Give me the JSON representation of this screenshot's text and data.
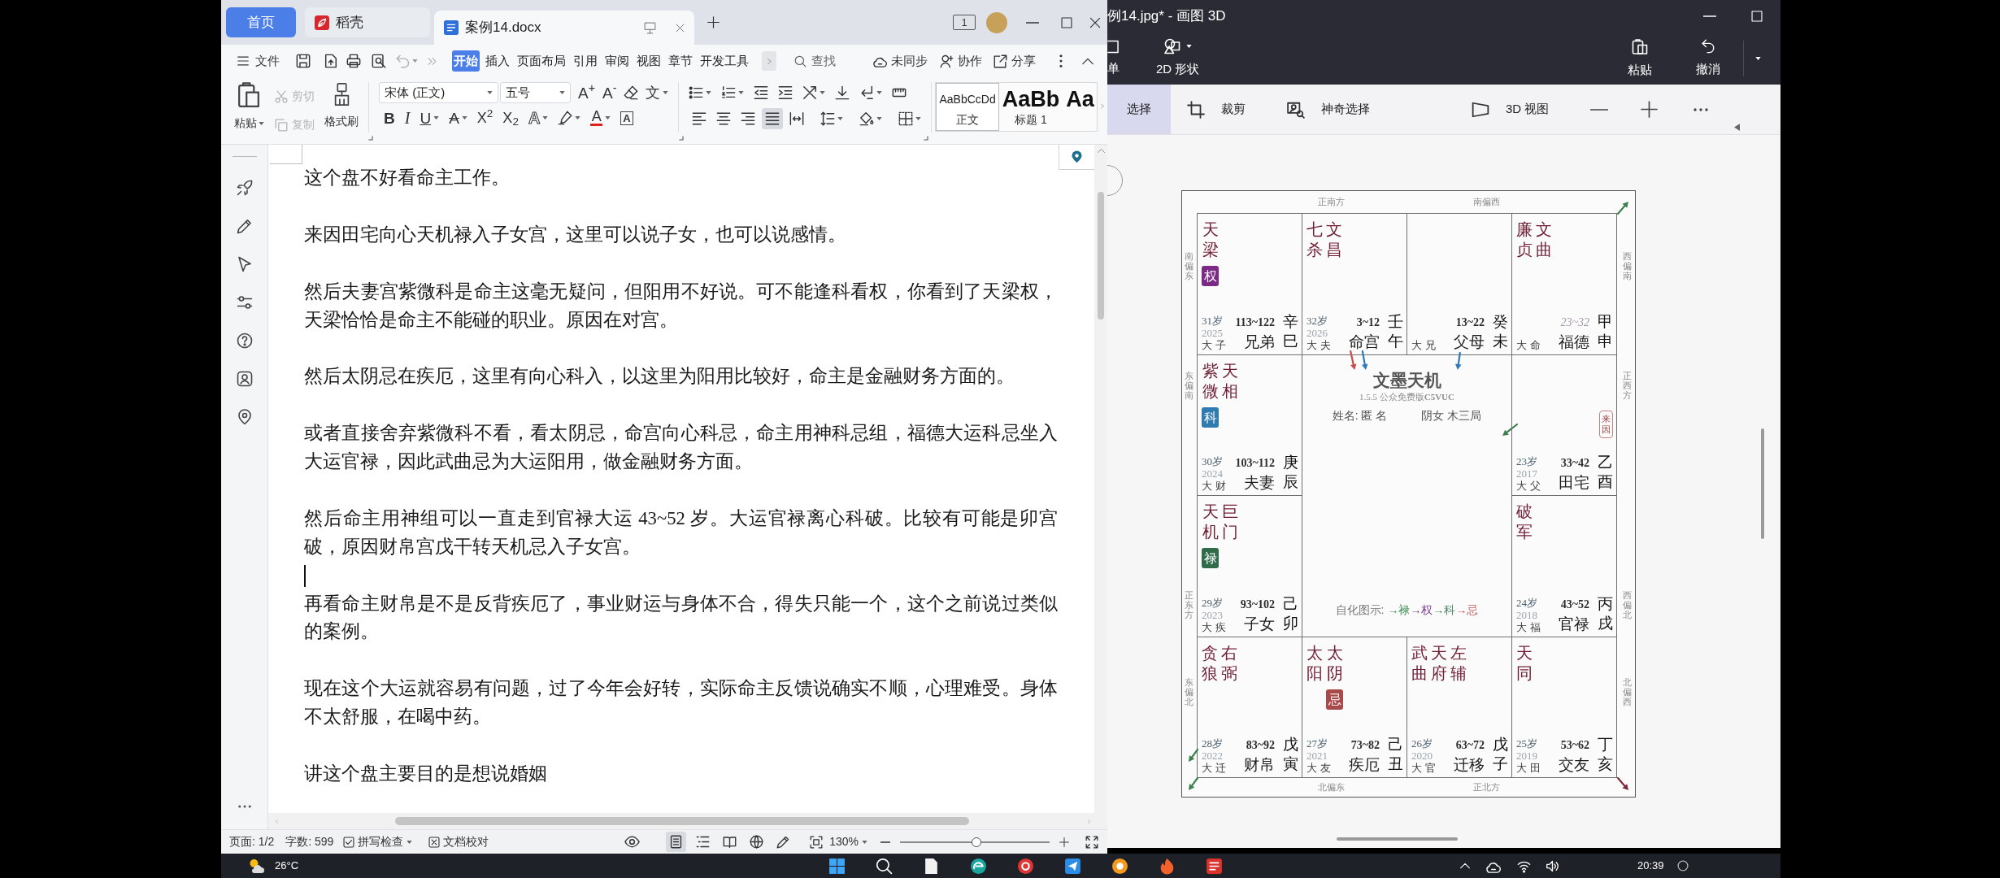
{
  "wps": {
    "tabs": [
      {
        "label": "首页",
        "kind": "home",
        "selected": false
      },
      {
        "label": "稻壳",
        "kind": "app",
        "selected": false
      },
      {
        "label": "案例14.docx",
        "kind": "document",
        "selected": true
      }
    ],
    "window_count": "1",
    "menu": {
      "file": "文件",
      "undo": {
        "disabled": true
      },
      "tabs": [
        {
          "label": "开始",
          "selected": true
        },
        {
          "label": "插入",
          "selected": false
        },
        {
          "label": "页面布局",
          "selected": false
        },
        {
          "label": "引用",
          "selected": false
        },
        {
          "label": "审阅",
          "selected": false
        },
        {
          "label": "视图",
          "selected": false
        },
        {
          "label": "章节",
          "selected": false
        },
        {
          "label": "开发工具",
          "selected": false
        }
      ],
      "search": "查找",
      "sync": "未同步",
      "collaborate": "协作",
      "share": "分享"
    },
    "ribbon": {
      "paste": "粘贴",
      "cut": {
        "label": "剪切",
        "disabled": true
      },
      "copy": {
        "label": "复制",
        "disabled": true
      },
      "format_painter": "格式刷",
      "font": "宋体 (正文)",
      "font_size": "五号",
      "font_buttons": [
        {
          "label": "A$^{+}$",
          "kind": "grow",
          "dropdown": false
        },
        {
          "label": "A$^{-}$",
          "kind": "shrink",
          "dropdown": false
        },
        {
          "label": "文",
          "kind": "phonetic",
          "dropdown": true
        },
        {
          "label": "B",
          "kind": "bold",
          "dropdown": false
        },
        {
          "label": "I",
          "kind": "italic",
          "dropdown": false
        },
        {
          "label": "U",
          "kind": "underline",
          "dropdown": true
        },
        {
          "label": "A",
          "kind": "strike",
          "dropdown": true
        },
        {
          "label": "X$^{2}$",
          "kind": "superscript",
          "dropdown": false
        },
        {
          "label": "X$_{2}$",
          "kind": "subscript",
          "dropdown": false
        },
        {
          "label": "A",
          "kind": "effect",
          "dropdown": true
        },
        {
          "label": "A",
          "kind": "color",
          "dropdown": true
        },
        {
          "label": "A",
          "kind": "border",
          "dropdown": false
        }
      ],
      "align_buttons": [
        {
          "selected": false
        },
        {
          "selected": false
        },
        {
          "selected": false
        },
        {
          "selected": true
        },
        {
          "selected": false
        }
      ],
      "styles": [
        {
          "preview": "AaBbCcDd",
          "label": "正文",
          "kind": "body",
          "selected": true
        },
        {
          "preview": "AaBb",
          "label": "标题 1",
          "kind": "heading",
          "selected": false
        },
        {
          "preview": "Aa",
          "kind": "heading",
          "selected": false
        }
      ]
    },
    "document": {
      "paragraphs": [
        {
          "text": "这个盘不好看命主工作。",
          "caret_below": false
        },
        {
          "text": "来因田宅向心天机禄入子女宫，这里可以说子女，也可以说感情。",
          "caret_below": false
        },
        {
          "text": "然后夫妻宫紫微科是命主这毫无疑问，但阳用不好说。可不能逢科看权，你看到了天梁权，天梁恰恰是命主不能碰的职业。原因在对宫。",
          "caret_below": false
        },
        {
          "text": "然后太阴忌在疾厄，这里有向心科入，以这里为阳用比较好，命主是金融财务方面的。",
          "caret_below": false
        },
        {
          "text": "或者直接舍弃紫微科不看，看太阴忌，命宫向心科忌，命主用神科忌组，福德大运科忌坐入大运官禄，因此武曲忌为大运阳用，做金融财务方面。",
          "caret_below": false
        },
        {
          "text": "然后命主用神组可以一直走到官禄大运 43~52 岁。大运官禄离心科破。比较有可能是卯宫破，原因财帛宫戊干转天机忌入子女宫。",
          "caret_below": true
        },
        {
          "text": "再看命主财帛是不是反背疾厄了，事业财运与身体不合，得失只能一个，这个之前说过类似的案例。",
          "caret_below": false
        },
        {
          "text": "现在这个大运就容易有问题，过了今年会好转，实际命主反馈说确实不顺，心理难受。身体不太舒服，在喝中药。",
          "caret_below": false
        },
        {
          "text": "讲这个盘主要目的是想说婚姻",
          "caret_below": false
        }
      ]
    },
    "status_bar": {
      "page": "页面: 1/2",
      "words": "字数: 599",
      "spell_check": "拼写检查",
      "proofread": "文档校对",
      "view_buttons": [
        {
          "selected": true
        },
        {
          "selected": false
        },
        {
          "selected": false
        },
        {
          "selected": false
        },
        {
          "selected": false
        }
      ],
      "zoom": "130%",
      "zoom_slider": {
        "level": 0.51
      }
    }
  },
  "paint3d": {
    "title": "例14.jpg* - 画图 3D",
    "ribbon": [
      {
        "label": "单"
      },
      {
        "label": "2D 形状"
      },
      {
        "label": "粘贴"
      },
      {
        "label": "撤消"
      }
    ],
    "tools": [
      {
        "label": "选择",
        "selected": true
      },
      {
        "label": "裁剪",
        "selected": false
      },
      {
        "label": "神奇选择",
        "selected": false
      },
      {
        "label": "3D 视图",
        "selected": false
      }
    ],
    "chart": {
      "directions": {
        "top": [
          "正南方",
          "南偏西"
        ],
        "left": [
          "南偏东",
          "东偏南",
          "正东方",
          "东偏北"
        ],
        "right": [
          "西偏南",
          "正西方",
          "西偏北",
          "北偏西"
        ],
        "bottom": [
          "北偏东",
          "正北方"
        ]
      },
      "palaces": [
        {
          "stars": [
            {
              "name": "天梁",
              "badge": {
                "text": "权",
                "color": "#7b2a86"
              }
            }
          ],
          "age": "31岁",
          "year": "2025",
          "decade": "大 子",
          "range": "113~122",
          "range_italic": false,
          "name": "兄弟",
          "stem": "辛",
          "branch": "巳"
        },
        {
          "stars": [
            {
              "name": "七杀"
            },
            {
              "name": "文昌"
            }
          ],
          "age": "32岁",
          "year": "2026",
          "decade": "大 夫",
          "range": "3~12",
          "range_italic": false,
          "name": "命宫",
          "stem": "壬",
          "branch": "午"
        },
        {
          "decade": "大 兄",
          "range": "13~22",
          "range_italic": false,
          "name": "父母",
          "stem": "癸",
          "branch": "未"
        },
        {
          "stars": [
            {
              "name": "廉贞"
            },
            {
              "name": "文曲"
            }
          ],
          "decade": "大 命",
          "range": "23~32",
          "range_italic": true,
          "name": "福德",
          "stem": "甲",
          "branch": "申"
        },
        {
          "stars": [
            {
              "name": "紫微",
              "badge": {
                "text": "科",
                "color": "#2f7bb0"
              }
            },
            {
              "name": "天相"
            }
          ],
          "age": "30岁",
          "year": "2024",
          "decade": "大 财",
          "range": "103~112",
          "range_italic": false,
          "name": "夫妻",
          "stem": "庚",
          "branch": "辰"
        },
        {
          "tag": "来因",
          "age": "23岁",
          "year": "2017",
          "decade": "大 父",
          "range": "33~42",
          "range_italic": false,
          "name": "田宅",
          "stem": "乙",
          "branch": "酉"
        },
        {
          "stars": [
            {
              "name": "天机",
              "badge": {
                "text": "禄",
                "color": "#2f6b48"
              }
            },
            {
              "name": "巨门"
            }
          ],
          "age": "29岁",
          "year": "2023",
          "decade": "大 疾",
          "range": "93~102",
          "range_italic": false,
          "name": "子女",
          "stem": "己",
          "branch": "卯"
        },
        {
          "stars": [
            {
              "name": "破军"
            }
          ],
          "age": "24岁",
          "year": "2018",
          "decade": "大 福",
          "range": "43~52",
          "range_italic": false,
          "name": "官禄",
          "stem": "丙",
          "branch": "戌"
        },
        {
          "stars": [
            {
              "name": "贪狼"
            },
            {
              "name": "右弼"
            }
          ],
          "age": "28岁",
          "year": "2022",
          "decade": "大 迁",
          "range": "83~92",
          "range_italic": false,
          "name": "财帛",
          "stem": "戊",
          "branch": "寅"
        },
        {
          "stars": [
            {
              "name": "太阳"
            },
            {
              "name": "太阴",
              "badge": {
                "text": "忌",
                "color": "#a84a4a"
              }
            }
          ],
          "age": "27岁",
          "year": "2021",
          "decade": "大 友",
          "range": "73~82",
          "range_italic": false,
          "name": "疾厄",
          "stem": "己",
          "branch": "丑"
        },
        {
          "stars": [
            {
              "name": "武曲"
            },
            {
              "name": "天府"
            },
            {
              "name": "左辅"
            }
          ],
          "age": "26岁",
          "year": "2020",
          "decade": "大 官",
          "range": "63~72",
          "range_italic": false,
          "name": "迁移",
          "stem": "戊",
          "branch": "子"
        },
        {
          "stars": [
            {
              "name": "天同"
            }
          ],
          "age": "25岁",
          "year": "2019",
          "decade": "大 田",
          "range": "53~62",
          "range_italic": false,
          "name": "交友",
          "stem": "丁",
          "branch": "亥"
        }
      ],
      "center": {
        "title": "文墨天机",
        "version": "1.5.5 公众免费版**C5VUC**",
        "name": "姓名: 匿 名",
        "profile": "阴女 木三局",
        "legend_label": "自化图示:",
        "legend": [
          {
            "text": "→禄",
            "color": "#3f8a55"
          },
          {
            "text": "→权",
            "color": "#7a3d8c"
          },
          {
            "text": "→科",
            "color": "#4d8a6a"
          },
          {
            "text": "→忌",
            "color": "#c05a5a"
          }
        ]
      }
    }
  },
  "taskbar": {
    "weather": "26°C",
    "time": "20:39"
  }
}
